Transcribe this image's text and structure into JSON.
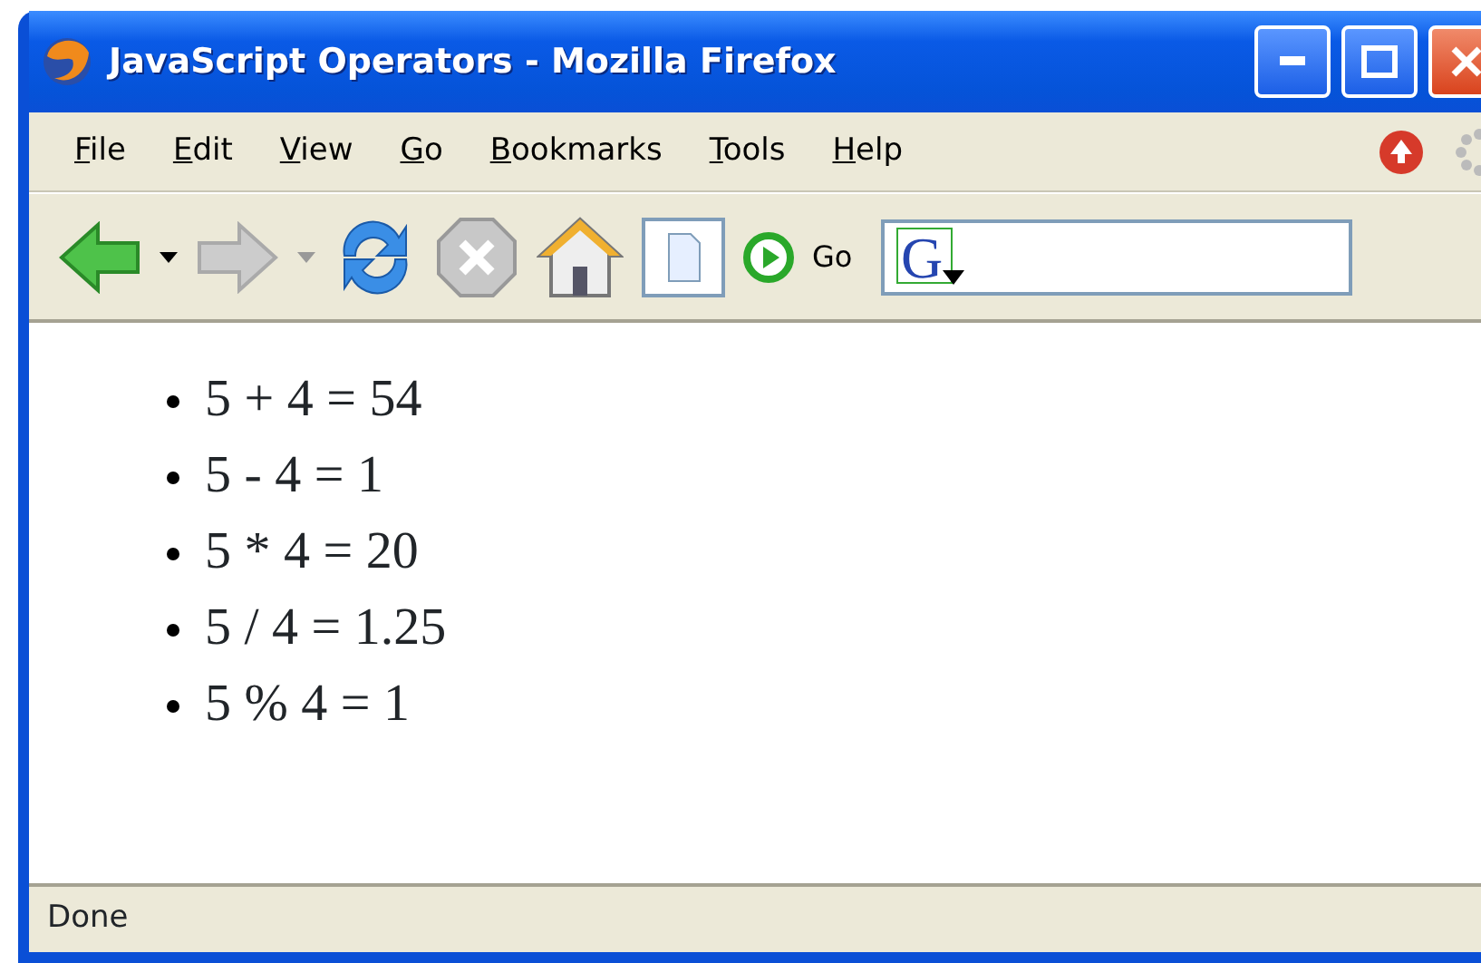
{
  "window": {
    "title": "JavaScript Operators - Mozilla Firefox"
  },
  "menu": [
    {
      "label": "File"
    },
    {
      "label": "Edit"
    },
    {
      "label": "View"
    },
    {
      "label": "Go"
    },
    {
      "label": "Bookmarks"
    },
    {
      "label": "Tools"
    },
    {
      "label": "Help"
    }
  ],
  "toolbar": {
    "go_label": "Go",
    "search_engine_letter": "G"
  },
  "content": {
    "items": [
      "5 + 4 = 54",
      "5 - 4 = 1",
      "5 * 4 = 20",
      "5 / 4 = 1.25",
      "5 % 4 = 1"
    ]
  },
  "status_bar": {
    "text": "Done"
  }
}
